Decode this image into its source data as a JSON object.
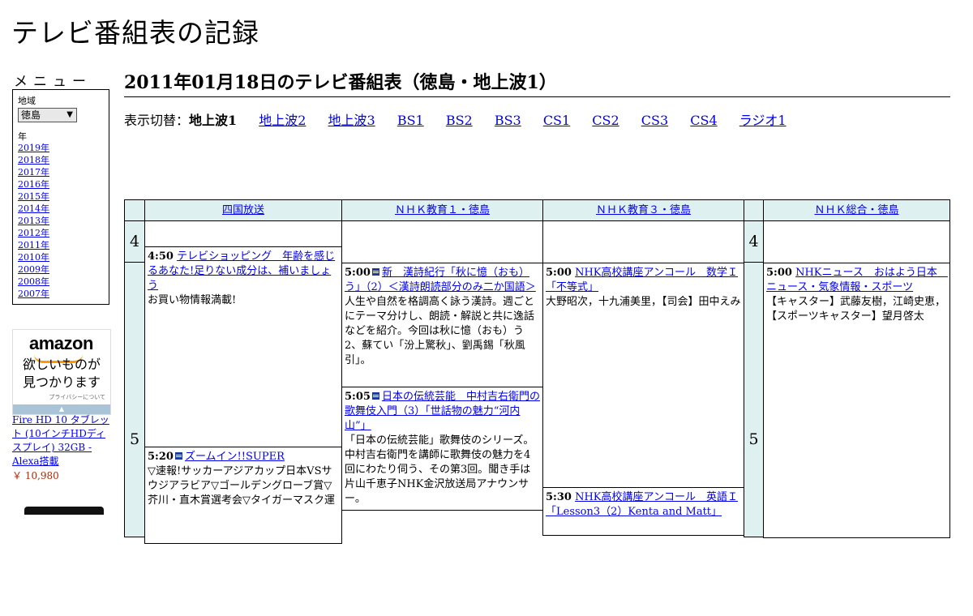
{
  "site": {
    "title": "テレビ番組表の記録"
  },
  "menu": {
    "heading": "メニュー",
    "region_label": "地域",
    "region_value": "徳島",
    "year_label": "年",
    "years": [
      "2019年",
      "2018年",
      "2017年",
      "2016年",
      "2015年",
      "2014年",
      "2013年",
      "2012年",
      "2011年",
      "2010年",
      "2009年",
      "2008年",
      "2007年"
    ]
  },
  "ad": {
    "logo": "amazon",
    "message_1": "欲しいものが",
    "message_2": "見つかります",
    "privacy": "プライバシーについて",
    "product": "Fire HD 10 タブレット (10インチHDディスプレイ) 32GB - Alexa搭載",
    "price": "￥ 10,980"
  },
  "page": {
    "title": "2011年01月18日のテレビ番組表（徳島・地上波1）"
  },
  "switcher": {
    "label": "表示切替：",
    "current": "地上波1",
    "links": [
      "地上波2",
      "地上波3",
      "BS1",
      "BS2",
      "BS3",
      "CS1",
      "CS2",
      "CS3",
      "CS4",
      "ラジオ1"
    ]
  },
  "channels": [
    "四国放送",
    "ＮＨＫ教育１・徳島",
    "ＮＨＫ教育３・徳島",
    "ＮＨＫ総合・徳島"
  ],
  "hours": [
    "4",
    "5"
  ],
  "programs": {
    "shikoku": [
      {
        "time": "4:50",
        "title": "テレビショッピング　年齢を感じるあなた!足りない成分は、補いましょう",
        "desc": "お買い物情報満載!"
      },
      {
        "time": "5:20",
        "title": "ズームイン!!SUPER",
        "desc": "▽速報!サッカーアジアカップ日本VSサウジアラビア▽ゴールデングローブ賞▽芥川・直木賞選考会▽タイガーマスク運"
      }
    ],
    "nhk_e1": [
      {
        "time": "5:00",
        "title": "新　漢詩紀行「秋に憶（おも）う」（2）＜漢詩朗読部分のみ二か国語＞",
        "desc": "人生や自然を格調高く詠う漢詩。週ごとにテーマ分けし、朗読・解説と共に逸話などを紹介。今回は秋に憶（おも）う2、蘇てい「汾上驚秋」、劉禹錫「秋風引」。"
      },
      {
        "time": "5:05",
        "title": "日本の伝統芸能　中村吉右衛門の歌舞伎入門（3）「世話物の魅力“河内山”」",
        "desc": "「日本の伝統芸能」歌舞伎のシリーズ。中村吉右衛門を講師に歌舞伎の魅力を4回にわたり伺う、その第3回。聞き手は片山千恵子NHK金沢放送局アナウンサー。"
      }
    ],
    "nhk_e3": [
      {
        "time": "5:00",
        "title": "NHK高校講座アンコール　数学Ｉ「不等式」",
        "desc": "大野昭次，十九浦美里，【司会】田中えみ"
      },
      {
        "time": "5:30",
        "title": "NHK高校講座アンコール　英語Ｉ「Lesson3（2）Kenta and Matt」",
        "desc": ""
      }
    ],
    "nhk_g": [
      {
        "time": "5:00",
        "title": "NHKニュース　おはよう日本　ニュース・気象情報・スポーツ",
        "desc": "【キャスター】武藤友樹，江崎史恵，【スポーツキャスター】望月啓太"
      }
    ]
  }
}
